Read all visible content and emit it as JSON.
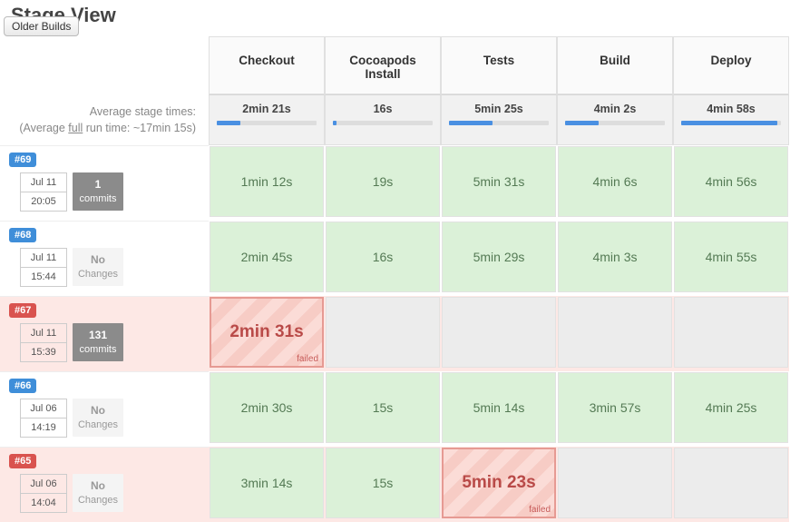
{
  "title": "Stage View",
  "older_builds_label": "Older Builds",
  "avg": {
    "line1": "Average stage times:",
    "line2_prefix": "(Average ",
    "line2_full": "full",
    "line2_rest": " run time: ~17min 15s)"
  },
  "stages": [
    "Checkout",
    "Cocoapods Install",
    "Tests",
    "Build",
    "Deploy"
  ],
  "stage_avgs": [
    "2min 21s",
    "16s",
    "5min 25s",
    "4min 2s",
    "4min 58s"
  ],
  "stage_bar_pct": [
    24,
    4,
    44,
    34,
    96
  ],
  "failed_label": "failed",
  "builds": [
    {
      "id": "#69",
      "badge_color": "blue",
      "date": "Jul 11",
      "time": "20:05",
      "commits_count": "1",
      "commits_label": "commits",
      "commits_style": "active",
      "row_fail": false,
      "cells": [
        {
          "status": "success",
          "text": "1min 12s"
        },
        {
          "status": "success",
          "text": "19s"
        },
        {
          "status": "success",
          "text": "5min 31s"
        },
        {
          "status": "success",
          "text": "4min 6s"
        },
        {
          "status": "success",
          "text": "4min 56s"
        }
      ]
    },
    {
      "id": "#68",
      "badge_color": "blue",
      "date": "Jul 11",
      "time": "15:44",
      "commits_count": "No",
      "commits_label": "Changes",
      "commits_style": "none",
      "row_fail": false,
      "cells": [
        {
          "status": "success",
          "text": "2min 45s"
        },
        {
          "status": "success",
          "text": "16s"
        },
        {
          "status": "success",
          "text": "5min 29s"
        },
        {
          "status": "success",
          "text": "4min 3s"
        },
        {
          "status": "success",
          "text": "4min 55s"
        }
      ]
    },
    {
      "id": "#67",
      "badge_color": "red",
      "date": "Jul 11",
      "time": "15:39",
      "commits_count": "131",
      "commits_label": "commits",
      "commits_style": "active",
      "row_fail": true,
      "cells": [
        {
          "status": "fail",
          "text": "2min 31s"
        },
        {
          "status": "skip",
          "text": ""
        },
        {
          "status": "skip",
          "text": ""
        },
        {
          "status": "skip",
          "text": ""
        },
        {
          "status": "skip",
          "text": ""
        }
      ]
    },
    {
      "id": "#66",
      "badge_color": "blue",
      "date": "Jul 06",
      "time": "14:19",
      "commits_count": "No",
      "commits_label": "Changes",
      "commits_style": "none",
      "row_fail": false,
      "cells": [
        {
          "status": "success",
          "text": "2min 30s"
        },
        {
          "status": "success",
          "text": "15s"
        },
        {
          "status": "success",
          "text": "5min 14s"
        },
        {
          "status": "success",
          "text": "3min 57s"
        },
        {
          "status": "success",
          "text": "4min 25s"
        }
      ]
    },
    {
      "id": "#65",
      "badge_color": "red",
      "date": "Jul 06",
      "time": "14:04",
      "commits_count": "No",
      "commits_label": "Changes",
      "commits_style": "none",
      "row_fail": true,
      "cells": [
        {
          "status": "success",
          "text": "3min 14s"
        },
        {
          "status": "success",
          "text": "15s"
        },
        {
          "status": "fail",
          "text": "5min 23s"
        },
        {
          "status": "skip",
          "text": ""
        },
        {
          "status": "skip",
          "text": ""
        }
      ]
    }
  ]
}
